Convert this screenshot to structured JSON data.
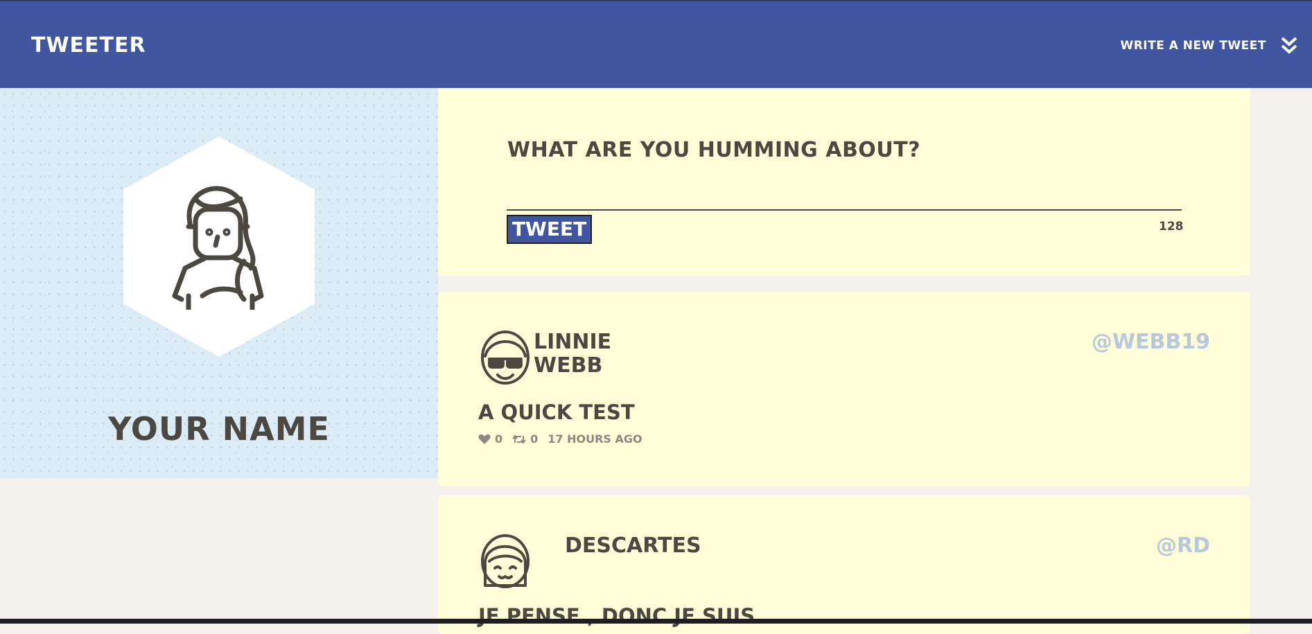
{
  "nav": {
    "brand": "Tweeter",
    "compose_label": "Write a new tweet",
    "compose_icon": "double-chevron-down-icon"
  },
  "profile": {
    "name": "Your Name",
    "avatar_icon": "girl-avatar-icon"
  },
  "composer": {
    "question": "What are you humming about?",
    "button_label": "Tweet",
    "counter": "128"
  },
  "tweets": [
    {
      "name": "Linnie Webb",
      "handle": "@webb19",
      "content": "A quick test",
      "likes": "0",
      "retweets": "0",
      "time": "17 hours ago",
      "avatar_icon": "sunglasses-avatar-icon"
    },
    {
      "name": "Descartes",
      "handle": "@rd",
      "content": "Je pense , donc je suis"
    }
  ],
  "colors": {
    "nav": "#4056a1",
    "card": "#fffdd8",
    "profile_bg": "#dcecf7",
    "handle": "#b6c8dd",
    "text": "#4a4840"
  }
}
